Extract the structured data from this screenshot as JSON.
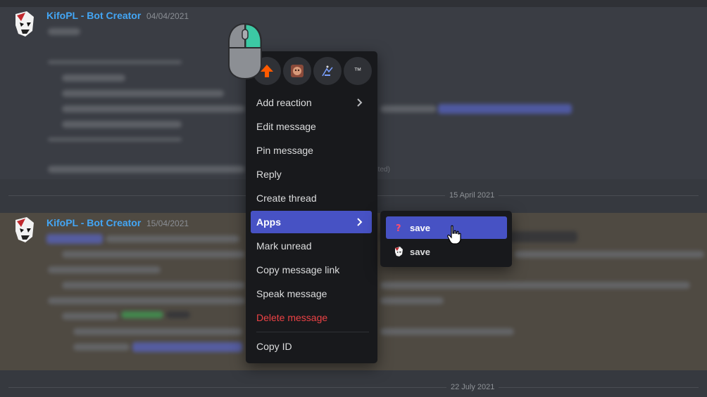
{
  "messages": [
    {
      "author": "KifoPL - Bot Creator",
      "timestamp": "04/04/2021",
      "edited": "(edited)"
    },
    {
      "author": "KifoPL - Bot Creator",
      "timestamp": "15/04/2021"
    }
  ],
  "dividers": [
    "15 April 2021",
    "22 July 2021"
  ],
  "reactions": [
    {
      "icon": "up-arrow-emoji"
    },
    {
      "icon": "custom-emoji-face"
    },
    {
      "icon": "custom-emoji-figure"
    },
    {
      "icon": "tm-emoji",
      "label": "™"
    }
  ],
  "context_menu": {
    "items": [
      {
        "label": "Add reaction",
        "has_submenu": true
      },
      {
        "label": "Edit message"
      },
      {
        "label": "Pin message"
      },
      {
        "label": "Reply"
      },
      {
        "label": "Create thread"
      },
      {
        "label": "Apps",
        "has_submenu": true,
        "active": true
      },
      {
        "label": "Mark unread"
      },
      {
        "label": "Copy message link"
      },
      {
        "label": "Speak message"
      },
      {
        "label": "Delete message",
        "danger": true
      },
      {
        "label": "Copy ID"
      }
    ]
  },
  "apps_submenu": {
    "items": [
      {
        "label": "save",
        "icon": "question-mark-icon",
        "active": true
      },
      {
        "label": "save",
        "icon": "bot-avatar-icon"
      }
    ]
  },
  "colors": {
    "accent": "#4752c4",
    "author": "#43a6f5",
    "danger": "#ed4245",
    "menu_bg": "#18191c",
    "mouse_highlight": "#3cc9a4"
  }
}
